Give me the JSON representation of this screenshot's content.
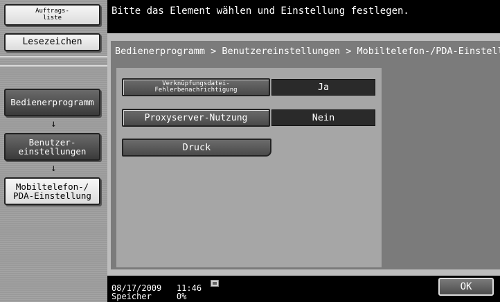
{
  "sidebar": {
    "job_list_label": "Auftrags-\nliste",
    "bookmark_label": "Lesezeichen",
    "breadcrumb_items": [
      {
        "label": "Bedienerprogramm"
      },
      {
        "label": "Benutzer-\neinstellungen"
      },
      {
        "label": "Mobiltelefon-/\nPDA-Einstellung"
      }
    ]
  },
  "header": {
    "message": "Bitte das Element wählen und Einstellung festlegen."
  },
  "breadcrumb": "Bedienerprogramm > Benutzereinstellungen > Mobiltelefon-/PDA-Einstellung",
  "settings": [
    {
      "label": "Verknüpfungsdatei-\nFehlerbenachrichtigung",
      "value": "Ja"
    },
    {
      "label": "Proxyserver-Nutzung",
      "value": "Nein"
    }
  ],
  "print_label": "Druck",
  "status": {
    "date": "08/17/2009",
    "time": "11:46",
    "memory_label": "Speicher",
    "memory_value": "0%"
  },
  "ok_label": "OK",
  "icons": {
    "arrow": "down-arrow-icon",
    "memory": "memory-icon"
  }
}
